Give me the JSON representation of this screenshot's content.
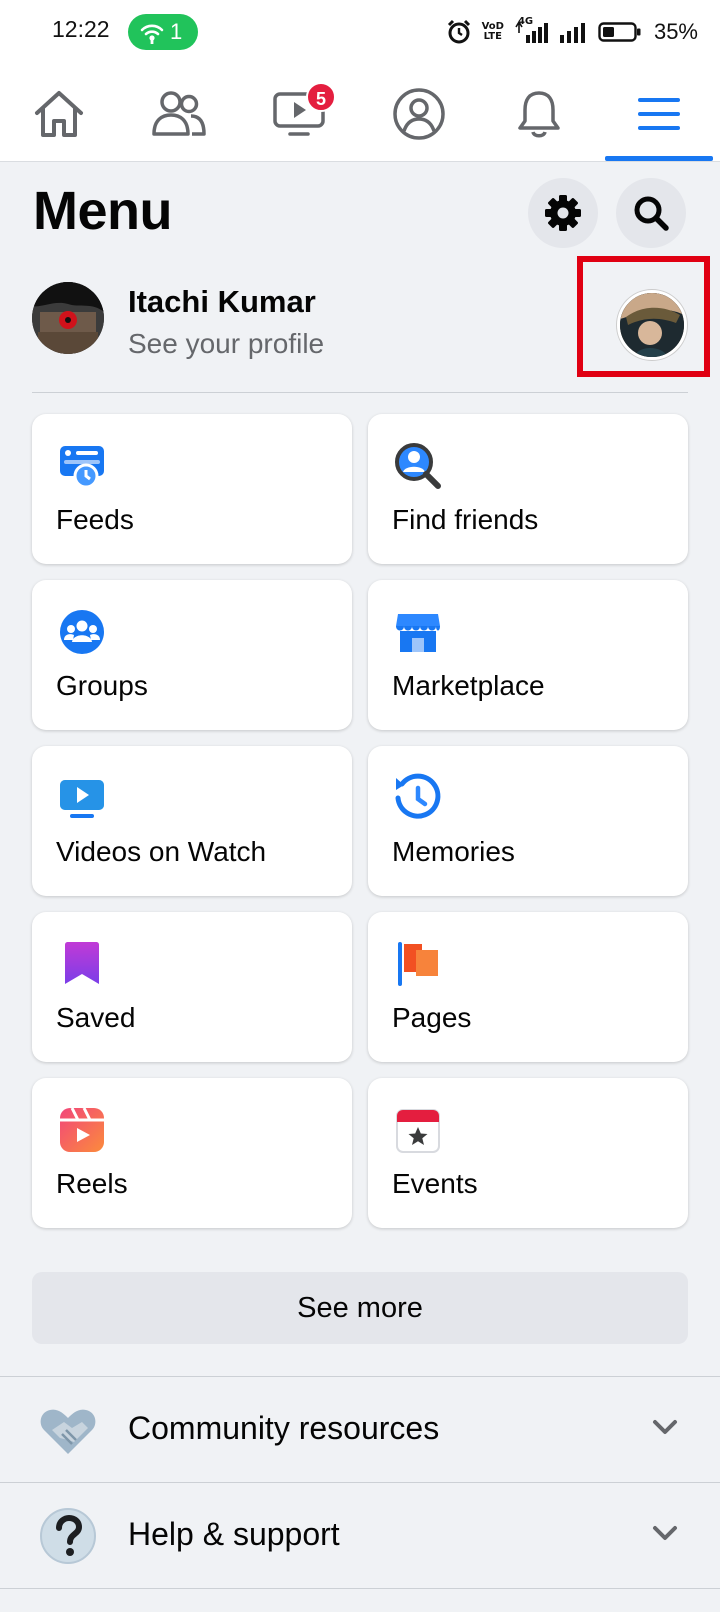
{
  "status_bar": {
    "time": "12:22",
    "hotspot_count": "1",
    "network_label_top": "VoD",
    "network_label_bottom": "LTE",
    "signal_label": "4G",
    "battery_percent": "35%"
  },
  "nav": {
    "tabs": [
      {
        "name": "home",
        "icon": "home-icon"
      },
      {
        "name": "friends",
        "icon": "friends-icon"
      },
      {
        "name": "watch",
        "icon": "watch-icon",
        "badge": "5"
      },
      {
        "name": "profile",
        "icon": "profile-icon"
      },
      {
        "name": "notifications",
        "icon": "bell-icon"
      },
      {
        "name": "menu",
        "icon": "hamburger-icon",
        "active": true
      }
    ]
  },
  "header": {
    "title": "Menu"
  },
  "profile": {
    "name": "Itachi Kumar",
    "subtitle": "See your profile"
  },
  "shortcuts": [
    {
      "label": "Feeds",
      "icon": "feeds-icon"
    },
    {
      "label": "Find friends",
      "icon": "find-friends-icon"
    },
    {
      "label": "Groups",
      "icon": "groups-icon"
    },
    {
      "label": "Marketplace",
      "icon": "marketplace-icon"
    },
    {
      "label": "Videos on Watch",
      "icon": "video-icon"
    },
    {
      "label": "Memories",
      "icon": "memories-icon"
    },
    {
      "label": "Saved",
      "icon": "saved-icon"
    },
    {
      "label": "Pages",
      "icon": "pages-flag-icon"
    },
    {
      "label": "Reels",
      "icon": "reels-icon"
    },
    {
      "label": "Events",
      "icon": "events-icon"
    }
  ],
  "see_more": "See more",
  "sections": [
    {
      "label": "Community resources",
      "icon": "handshake-icon"
    },
    {
      "label": "Help & support",
      "icon": "question-icon"
    }
  ],
  "colors": {
    "accent": "#1877f2",
    "badge": "#e41e3f",
    "hotspot": "#21c35b",
    "highlight": "#e00012",
    "background": "#f0f2f5"
  }
}
